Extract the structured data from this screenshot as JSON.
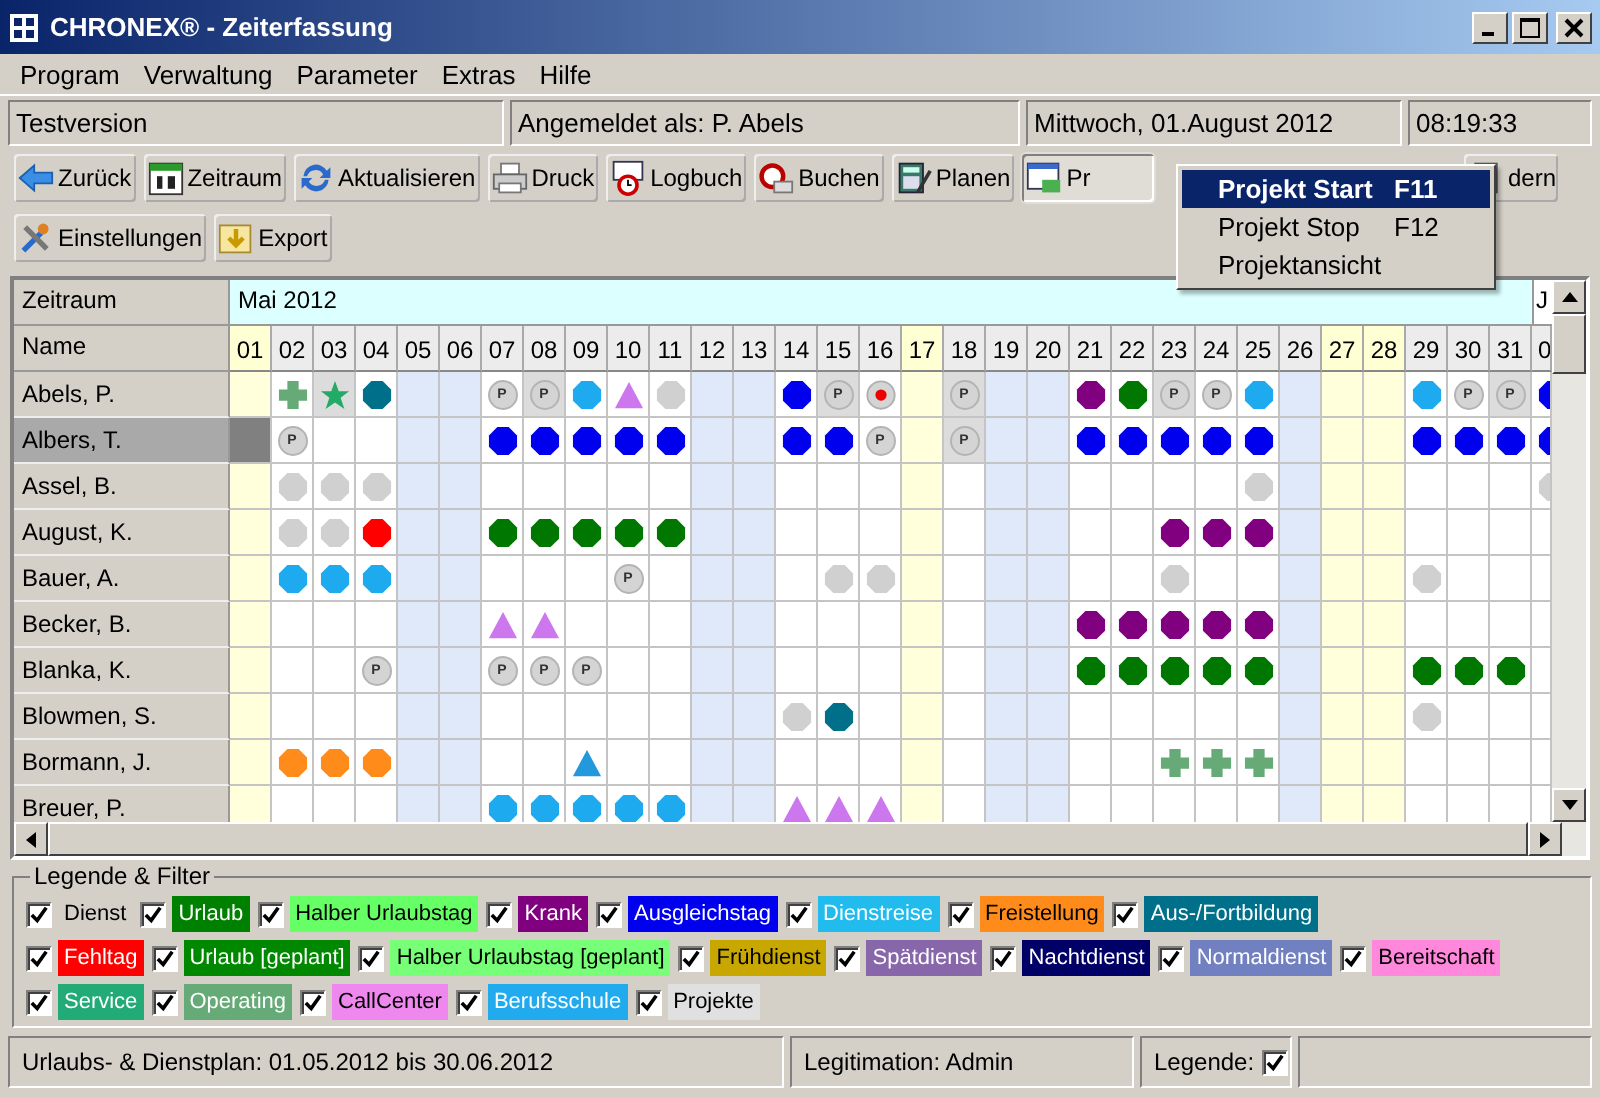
{
  "window": {
    "title": "CHRONEX® - Zeiterfassung"
  },
  "menu": [
    "Program",
    "Verwaltung",
    "Parameter",
    "Extras",
    "Hilfe"
  ],
  "info_bar": [
    "Testversion",
    "Angemeldet als: P. Abels",
    "Mittwoch, 01.August 2012",
    "08:19:33"
  ],
  "toolbar": [
    [
      {
        "label": "Zurück",
        "pressed": false
      },
      {
        "label": "Zeitraum",
        "pressed": false
      },
      {
        "label": "Aktualisieren",
        "pressed": false
      },
      {
        "label": "Druck",
        "pressed": false
      },
      {
        "label": "Logbuch",
        "pressed": false
      },
      {
        "label": "Buchen",
        "pressed": false
      },
      {
        "label": "Planen",
        "pressed": false
      },
      {
        "label": "Pr",
        "pressed": true
      },
      {
        "label": "dern",
        "pressed": false
      }
    ],
    [
      {
        "label": "Einstellungen",
        "pressed": false
      },
      {
        "label": "Export",
        "pressed": false
      }
    ]
  ],
  "dropdown": [
    {
      "label": "Projekt Start",
      "shortcut": "F11",
      "selected": true
    },
    {
      "label": "Projekt Stop",
      "shortcut": "F12",
      "selected": false
    },
    {
      "label": "Projektansicht",
      "selected": false
    }
  ],
  "grid": {
    "period_label": "Zeitraum",
    "name_label": "Name",
    "month": "Mai 2012",
    "next_month": "J",
    "days": [
      {
        "label": "01",
        "kind": "holiday"
      },
      {
        "label": "02",
        "kind": "workday"
      },
      {
        "label": "03",
        "kind": "workday"
      },
      {
        "label": "04",
        "kind": "workday"
      },
      {
        "label": "05",
        "kind": "weekend"
      },
      {
        "label": "06",
        "kind": "weekend"
      },
      {
        "label": "07",
        "kind": "workday"
      },
      {
        "label": "08",
        "kind": "workday"
      },
      {
        "label": "09",
        "kind": "workday"
      },
      {
        "label": "10",
        "kind": "workday"
      },
      {
        "label": "11",
        "kind": "workday"
      },
      {
        "label": "12",
        "kind": "weekend"
      },
      {
        "label": "13",
        "kind": "weekend"
      },
      {
        "label": "14",
        "kind": "workday"
      },
      {
        "label": "15",
        "kind": "workday"
      },
      {
        "label": "16",
        "kind": "workday"
      },
      {
        "label": "17",
        "kind": "holiday"
      },
      {
        "label": "18",
        "kind": "workday"
      },
      {
        "label": "19",
        "kind": "weekend"
      },
      {
        "label": "20",
        "kind": "weekend"
      },
      {
        "label": "21",
        "kind": "workday"
      },
      {
        "label": "22",
        "kind": "workday"
      },
      {
        "label": "23",
        "kind": "workday"
      },
      {
        "label": "24",
        "kind": "workday"
      },
      {
        "label": "25",
        "kind": "workday"
      },
      {
        "label": "26",
        "kind": "weekend"
      },
      {
        "label": "27",
        "kind": "holiday"
      },
      {
        "label": "28",
        "kind": "holiday"
      },
      {
        "label": "29",
        "kind": "workday"
      },
      {
        "label": "30",
        "kind": "workday"
      },
      {
        "label": "31",
        "kind": "workday"
      },
      {
        "label": "0",
        "kind": "workday"
      }
    ],
    "rows": [
      {
        "name": "Abels, P.",
        "selected": false,
        "cells": [
          null,
          {
            "kind": "cross",
            "color": "#66aa77",
            "shaded": false
          },
          {
            "kind": "star",
            "color": "#22aa66",
            "shaded": true
          },
          {
            "kind": "dot",
            "color": "#00708a",
            "shaded": false
          },
          null,
          null,
          {
            "kind": "badge",
            "label": "P",
            "shaded": false
          },
          {
            "kind": "badge",
            "label": "P",
            "shaded": true
          },
          {
            "kind": "dot",
            "color": "#1eaaee",
            "shaded": false
          },
          {
            "kind": "triangle",
            "color": "#cc77ee",
            "shaded": false
          },
          {
            "kind": "dot",
            "color": "#d0d0d0",
            "shaded": false
          },
          null,
          null,
          {
            "kind": "dot",
            "color": "#0000ee",
            "shaded": false
          },
          {
            "kind": "badge",
            "label": "P",
            "shaded": true
          },
          {
            "kind": "alert",
            "shaded": false
          },
          null,
          {
            "kind": "badge",
            "label": "P",
            "shaded": true
          },
          null,
          null,
          {
            "kind": "dot",
            "color": "#800080",
            "shaded": false
          },
          {
            "kind": "dot",
            "color": "#007700",
            "shaded": false
          },
          {
            "kind": "badge",
            "label": "P",
            "shaded": true
          },
          {
            "kind": "badge",
            "label": "P",
            "shaded": false
          },
          {
            "kind": "dot",
            "color": "#1eaaee",
            "shaded": false
          },
          null,
          null,
          null,
          {
            "kind": "dot",
            "color": "#1eaaee",
            "shaded": false
          },
          {
            "kind": "badge",
            "label": "P",
            "shaded": false
          },
          {
            "kind": "badge",
            "label": "P",
            "shaded": true
          },
          {
            "kind": "dot",
            "color": "#0000ee",
            "shaded": false
          }
        ]
      },
      {
        "name": "Albers, T.",
        "selected": true,
        "cells": [
          {
            "kind": "cursor"
          },
          {
            "kind": "badge",
            "label": "P",
            "shaded": false
          },
          null,
          null,
          null,
          null,
          {
            "kind": "dot",
            "color": "#0000ee",
            "shaded": false
          },
          {
            "kind": "dot",
            "color": "#0000ee",
            "shaded": false
          },
          {
            "kind": "dot",
            "color": "#0000ee",
            "shaded": false
          },
          {
            "kind": "dot",
            "color": "#0000ee",
            "shaded": false
          },
          {
            "kind": "dot",
            "color": "#0000ee",
            "shaded": false
          },
          null,
          null,
          {
            "kind": "dot",
            "color": "#0000ee",
            "shaded": false
          },
          {
            "kind": "dot",
            "color": "#0000ee",
            "shaded": false
          },
          {
            "kind": "badge",
            "label": "P",
            "shaded": false
          },
          null,
          {
            "kind": "badge",
            "label": "P",
            "shaded": true
          },
          null,
          null,
          {
            "kind": "dot",
            "color": "#0000ee",
            "shaded": false
          },
          {
            "kind": "dot",
            "color": "#0000ee",
            "shaded": false
          },
          {
            "kind": "dot",
            "color": "#0000ee",
            "shaded": false
          },
          {
            "kind": "dot",
            "color": "#0000ee",
            "shaded": false
          },
          {
            "kind": "dot",
            "color": "#0000ee",
            "shaded": false
          },
          null,
          null,
          null,
          {
            "kind": "dot",
            "color": "#0000ee",
            "shaded": false
          },
          {
            "kind": "dot",
            "color": "#0000ee",
            "shaded": false
          },
          {
            "kind": "dot",
            "color": "#0000ee",
            "shaded": false
          },
          {
            "kind": "dot",
            "color": "#0000ee",
            "shaded": false
          }
        ]
      },
      {
        "name": "Assel, B.",
        "selected": false,
        "cells": [
          null,
          {
            "kind": "dot",
            "color": "#d0d0d0",
            "shaded": false
          },
          {
            "kind": "dot",
            "color": "#d0d0d0",
            "shaded": false
          },
          {
            "kind": "dot",
            "color": "#d0d0d0",
            "shaded": false
          },
          null,
          null,
          null,
          null,
          null,
          null,
          null,
          null,
          null,
          null,
          null,
          null,
          null,
          null,
          null,
          null,
          null,
          null,
          null,
          null,
          {
            "kind": "dot",
            "color": "#d0d0d0",
            "shaded": false
          },
          null,
          null,
          null,
          null,
          null,
          null,
          {
            "kind": "dot",
            "color": "#d0d0d0",
            "shaded": false
          }
        ]
      },
      {
        "name": "August, K.",
        "selected": false,
        "cells": [
          null,
          {
            "kind": "dot",
            "color": "#d0d0d0",
            "shaded": false
          },
          {
            "kind": "dot",
            "color": "#d0d0d0",
            "shaded": false
          },
          {
            "kind": "dot",
            "color": "#ff0000",
            "shaded": false
          },
          null,
          null,
          {
            "kind": "dot",
            "color": "#007700",
            "shaded": false
          },
          {
            "kind": "dot",
            "color": "#007700",
            "shaded": false
          },
          {
            "kind": "dot",
            "color": "#007700",
            "shaded": false
          },
          {
            "kind": "dot",
            "color": "#007700",
            "shaded": false
          },
          {
            "kind": "dot",
            "color": "#007700",
            "shaded": false
          },
          null,
          null,
          null,
          null,
          null,
          null,
          null,
          null,
          null,
          null,
          null,
          {
            "kind": "dot",
            "color": "#800080",
            "shaded": false
          },
          {
            "kind": "dot",
            "color": "#800080",
            "shaded": false
          },
          {
            "kind": "dot",
            "color": "#800080",
            "shaded": false
          },
          null,
          null,
          null,
          null,
          null,
          null,
          null
        ]
      },
      {
        "name": "Bauer, A.",
        "selected": false,
        "cells": [
          null,
          {
            "kind": "dot",
            "color": "#1eaaee",
            "shaded": false
          },
          {
            "kind": "dot",
            "color": "#1eaaee",
            "shaded": false
          },
          {
            "kind": "dot",
            "color": "#1eaaee",
            "shaded": false
          },
          null,
          null,
          null,
          null,
          null,
          {
            "kind": "badge",
            "label": "P",
            "shaded": false
          },
          null,
          null,
          null,
          null,
          {
            "kind": "dot",
            "color": "#d0d0d0",
            "shaded": false
          },
          {
            "kind": "dot",
            "color": "#d0d0d0",
            "shaded": false
          },
          null,
          null,
          null,
          null,
          null,
          null,
          {
            "kind": "dot",
            "color": "#d0d0d0",
            "shaded": false
          },
          null,
          null,
          null,
          null,
          null,
          {
            "kind": "dot",
            "color": "#d0d0d0",
            "shaded": false
          },
          null,
          null,
          null
        ]
      },
      {
        "name": "Becker, B.",
        "selected": false,
        "cells": [
          null,
          null,
          null,
          null,
          null,
          null,
          {
            "kind": "triangle",
            "color": "#cc77ee",
            "shaded": false
          },
          {
            "kind": "triangle",
            "color": "#cc77ee",
            "shaded": false
          },
          null,
          null,
          null,
          null,
          null,
          null,
          null,
          null,
          null,
          null,
          null,
          null,
          {
            "kind": "dot",
            "color": "#800080",
            "shaded": false
          },
          {
            "kind": "dot",
            "color": "#800080",
            "shaded": false
          },
          {
            "kind": "dot",
            "color": "#800080",
            "shaded": false
          },
          {
            "kind": "dot",
            "color": "#800080",
            "shaded": false
          },
          {
            "kind": "dot",
            "color": "#800080",
            "shaded": false
          },
          null,
          null,
          null,
          null,
          null,
          null,
          null
        ]
      },
      {
        "name": "Blanka, K.",
        "selected": false,
        "cells": [
          null,
          null,
          null,
          {
            "kind": "badge",
            "label": "P",
            "shaded": false
          },
          null,
          null,
          {
            "kind": "badge",
            "label": "P",
            "shaded": false
          },
          {
            "kind": "badge",
            "label": "P",
            "shaded": false
          },
          {
            "kind": "badge",
            "label": "P",
            "shaded": false
          },
          null,
          null,
          null,
          null,
          null,
          null,
          null,
          null,
          null,
          null,
          null,
          {
            "kind": "dot",
            "color": "#007700",
            "shaded": false
          },
          {
            "kind": "dot",
            "color": "#007700",
            "shaded": false
          },
          {
            "kind": "dot",
            "color": "#007700",
            "shaded": false
          },
          {
            "kind": "dot",
            "color": "#007700",
            "shaded": false
          },
          {
            "kind": "dot",
            "color": "#007700",
            "shaded": false
          },
          null,
          null,
          null,
          {
            "kind": "dot",
            "color": "#007700",
            "shaded": false
          },
          {
            "kind": "dot",
            "color": "#007700",
            "shaded": false
          },
          {
            "kind": "dot",
            "color": "#007700",
            "shaded": false
          },
          null
        ]
      },
      {
        "name": "Blowmen, S.",
        "selected": false,
        "cells": [
          null,
          null,
          null,
          null,
          null,
          null,
          null,
          null,
          null,
          null,
          null,
          null,
          null,
          {
            "kind": "dot",
            "color": "#d0d0d0",
            "shaded": false
          },
          {
            "kind": "dot",
            "color": "#00708a",
            "shaded": false
          },
          null,
          null,
          null,
          null,
          null,
          null,
          null,
          null,
          null,
          null,
          null,
          null,
          null,
          {
            "kind": "dot",
            "color": "#d0d0d0",
            "shaded": false
          },
          null,
          null,
          null
        ]
      },
      {
        "name": "Bormann, J.",
        "selected": false,
        "cells": [
          null,
          {
            "kind": "dot",
            "color": "#ff8c1a",
            "shaded": false
          },
          {
            "kind": "dot",
            "color": "#ff8c1a",
            "shaded": false
          },
          {
            "kind": "dot",
            "color": "#ff8c1a",
            "shaded": false
          },
          null,
          null,
          null,
          null,
          {
            "kind": "triangle",
            "color": "#2299dd",
            "shaded": false
          },
          null,
          null,
          null,
          null,
          null,
          null,
          null,
          null,
          null,
          null,
          null,
          null,
          null,
          {
            "kind": "cross",
            "color": "#66aa77",
            "shaded": false
          },
          {
            "kind": "cross",
            "color": "#66aa77",
            "shaded": false
          },
          {
            "kind": "cross",
            "color": "#66aa77",
            "shaded": false
          },
          null,
          null,
          null,
          null,
          null,
          null,
          null
        ]
      },
      {
        "name": "Breuer, P.",
        "selected": false,
        "cells": [
          null,
          null,
          null,
          null,
          null,
          null,
          {
            "kind": "dot",
            "color": "#1eaaee",
            "shaded": false
          },
          {
            "kind": "dot",
            "color": "#1eaaee",
            "shaded": false
          },
          {
            "kind": "dot",
            "color": "#1eaaee",
            "shaded": false
          },
          {
            "kind": "dot",
            "color": "#1eaaee",
            "shaded": false
          },
          {
            "kind": "dot",
            "color": "#1eaaee",
            "shaded": false
          },
          null,
          null,
          {
            "kind": "triangle",
            "color": "#cc77ee",
            "shaded": false
          },
          {
            "kind": "triangle",
            "color": "#cc77ee",
            "shaded": false
          },
          {
            "kind": "triangle",
            "color": "#cc77ee",
            "shaded": false
          },
          null,
          null,
          null,
          null,
          null,
          null,
          null,
          null,
          null,
          null,
          null,
          null,
          null,
          null,
          null,
          null
        ]
      }
    ]
  },
  "legend": {
    "title": "Legende & Filter",
    "rows": [
      {
        "items": [
          {
            "label": "Dienst",
            "checked": true
          },
          {
            "label": "Urlaub",
            "checked": true,
            "color": "#008000"
          },
          {
            "label": "Halber Urlaubstag",
            "checked": true,
            "color": "#66ff66"
          },
          {
            "label": "Krank",
            "checked": true,
            "color": "#800080"
          },
          {
            "label": "Ausgleichstag",
            "checked": true,
            "color": "#0000ee"
          },
          {
            "label": "Dienstreise",
            "checked": true,
            "color": "#22bbee"
          },
          {
            "label": "Freistellung",
            "checked": true,
            "color": "#ff8c1a"
          },
          {
            "label": "Aus-/Fortbildung",
            "checked": true,
            "color": "#00708a"
          }
        ]
      },
      {
        "items": [
          {
            "label": "Fehltag",
            "checked": true,
            "color": "#ff0000"
          },
          {
            "label": "Urlaub [geplant]",
            "checked": true,
            "color": "#008800"
          },
          {
            "label": "Halber Urlaubstag [geplant]",
            "checked": true,
            "color": "#77ff77"
          },
          {
            "label": "Frühdienst",
            "checked": true,
            "color": "#c8a800"
          },
          {
            "label": "Spätdienst",
            "checked": true,
            "color": "#8866aa"
          },
          {
            "label": "Nachtdienst",
            "checked": true,
            "color": "#000066"
          },
          {
            "label": "Normaldienst",
            "checked": true,
            "color": "#7080c0"
          },
          {
            "label": "Bereitschaft",
            "checked": true,
            "color": "#ff88dd"
          }
        ]
      },
      {
        "items": [
          {
            "label": "Service",
            "checked": true,
            "color": "#22aa77"
          },
          {
            "label": "Operating",
            "checked": true,
            "color": "#66aa77"
          },
          {
            "label": "CallCenter",
            "checked": true,
            "color": "#ee88ee"
          },
          {
            "label": "Berufsschule",
            "checked": true,
            "color": "#22aaee"
          },
          {
            "label": "Projekte",
            "checked": true,
            "color": "#e0e0e0"
          }
        ]
      }
    ]
  },
  "status_bar": {
    "plan": "Urlaubs- & Dienstplan: 01.05.2012 bis 30.06.2012",
    "role": "Legitimation: Admin",
    "legend_label": "Legende:",
    "legend_checked": true
  }
}
